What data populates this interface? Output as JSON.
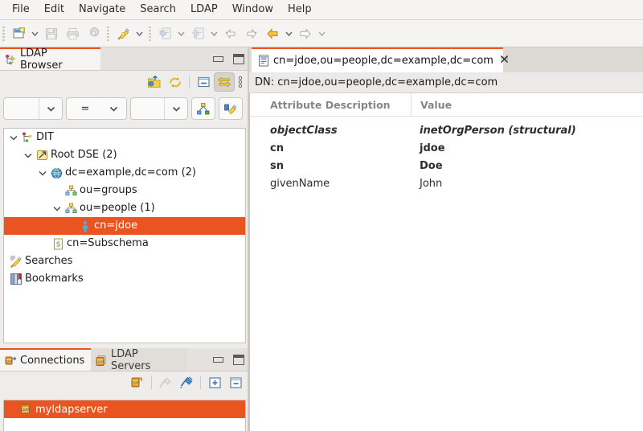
{
  "app": {
    "selection_color": "#e95420",
    "panel_bg": "#efedeb",
    "window_bg": "#f2f1f0"
  },
  "menubar": {
    "items": [
      {
        "label": "File"
      },
      {
        "label": "Edit"
      },
      {
        "label": "Navigate"
      },
      {
        "label": "Search"
      },
      {
        "label": "LDAP"
      },
      {
        "label": "Window"
      },
      {
        "label": "Help"
      }
    ]
  },
  "toolbar": {
    "groups": [
      {
        "buttons": [
          {
            "icon": "new-document-icon",
            "name": "new-button",
            "dropdown": true,
            "enabled": true
          },
          {
            "icon": "save-icon",
            "name": "save-button",
            "dropdown": false,
            "enabled": false
          },
          {
            "icon": "print-icon",
            "name": "print-button",
            "dropdown": false,
            "enabled": false
          },
          {
            "icon": "gear-icon",
            "name": "preferences-button",
            "dropdown": false,
            "enabled": false
          }
        ]
      },
      {
        "buttons": [
          {
            "icon": "new-search-icon",
            "name": "new-search-button",
            "dropdown": true,
            "enabled": true
          }
        ]
      },
      {
        "buttons": [
          {
            "icon": "import-icon",
            "name": "import-button",
            "dropdown": true,
            "enabled": false
          },
          {
            "icon": "export-icon",
            "name": "export-button",
            "dropdown": true,
            "enabled": false
          },
          {
            "icon": "back-history-icon",
            "name": "back-history-button",
            "dropdown": false,
            "enabled": false
          },
          {
            "icon": "forward-history-icon",
            "name": "forward-history-button",
            "dropdown": false,
            "enabled": false
          },
          {
            "icon": "back-arrow-icon",
            "name": "back-button",
            "dropdown": true,
            "enabled": true
          },
          {
            "icon": "forward-arrow-icon",
            "name": "forward-button",
            "dropdown": true,
            "enabled": false
          }
        ]
      }
    ]
  },
  "browser_panel": {
    "tab_label": "LDAP Browser",
    "tab_icon": "ldap-browser-icon",
    "minimize_tooltip": "Minimize",
    "maximize_tooltip": "Maximize",
    "toolbar": [
      {
        "name": "up-one-level-button",
        "icon": "up-folder-icon",
        "active": false
      },
      {
        "name": "refresh-button",
        "icon": "refresh-icon",
        "active": false
      },
      {
        "name": "collapse-all-button",
        "icon": "collapse-all-icon",
        "active": false
      },
      {
        "name": "link-with-editor-button",
        "icon": "link-editor-icon",
        "active": true
      },
      {
        "name": "view-menu-button",
        "icon": "view-menu-icon",
        "active": false
      }
    ],
    "filter": {
      "attribute_value": "",
      "attribute_placeholder": "",
      "operator_value": "=",
      "value_value": "",
      "value_placeholder": "",
      "scope_button": "quick-filter-icon",
      "clear_button": "clear-filter-icon"
    },
    "tree": [
      {
        "indent": 0,
        "twisty": "expanded",
        "icon": "dit-icon",
        "label": "DIT",
        "selected": false
      },
      {
        "indent": 1,
        "twisty": "expanded",
        "icon": "rootdse-icon",
        "label": "Root DSE (2)",
        "selected": false
      },
      {
        "indent": 2,
        "twisty": "expanded",
        "icon": "domain-icon",
        "label": "dc=example,dc=com (2)",
        "selected": false
      },
      {
        "indent": 3,
        "twisty": "none",
        "icon": "org-unit-icon",
        "label": "ou=groups",
        "selected": false
      },
      {
        "indent": 3,
        "twisty": "expanded",
        "icon": "org-unit-icon",
        "label": "ou=people (1)",
        "selected": false
      },
      {
        "indent": 4,
        "twisty": "none",
        "icon": "person-icon",
        "label": "cn=jdoe",
        "selected": true
      },
      {
        "indent": 2,
        "twisty": "none",
        "icon": "schema-icon",
        "label": "cn=Subschema",
        "selected": false
      },
      {
        "indent": 0,
        "twisty": "none",
        "icon": "searches-icon",
        "label": "Searches",
        "selected": false
      },
      {
        "indent": 0,
        "twisty": "none",
        "icon": "bookmarks-icon",
        "label": "Bookmarks",
        "selected": false
      }
    ]
  },
  "connections_panel": {
    "tabs": [
      {
        "label": "Connections",
        "icon": "connections-icon",
        "active": true
      },
      {
        "label": "LDAP Servers",
        "icon": "ldap-servers-icon",
        "active": false
      }
    ],
    "toolbar": [
      {
        "name": "new-connection-button",
        "icon": "new-connection-icon",
        "enabled": true
      },
      {
        "name": "disconnect-button",
        "icon": "disconnect-icon",
        "enabled": false
      },
      {
        "name": "connect-button",
        "icon": "connect-icon",
        "enabled": true
      },
      {
        "name": "expand-all-button",
        "icon": "expand-all-icon",
        "enabled": true
      },
      {
        "name": "collapse-all-button",
        "icon": "collapse-all-icon",
        "enabled": true
      }
    ],
    "connections": [
      {
        "label": "myldapserver",
        "icon": "ldap-connection-icon",
        "selected": true
      }
    ]
  },
  "editor": {
    "tab": {
      "label": "cn=jdoe,ou=people,dc=example,dc=com",
      "icon": "entry-editor-icon",
      "close_glyph": "✖",
      "active": true
    },
    "dn_bar": "DN: cn=jdoe,ou=people,dc=example,dc=com",
    "table": {
      "columns": [
        "Attribute Description",
        "Value"
      ],
      "rows": [
        {
          "attribute": "objectClass",
          "value": "inetOrgPerson (structural)",
          "style": "bold-italic"
        },
        {
          "attribute": "cn",
          "value": "jdoe",
          "style": "bold"
        },
        {
          "attribute": "sn",
          "value": "Doe",
          "style": "bold"
        },
        {
          "attribute": "givenName",
          "value": "John",
          "style": "normal"
        }
      ]
    }
  }
}
